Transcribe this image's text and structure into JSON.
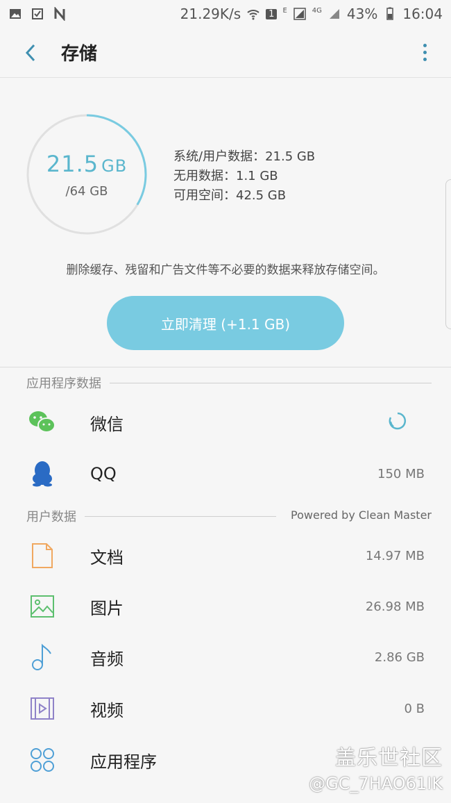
{
  "status_bar": {
    "speed": "21.29K/s",
    "sim_badge": "1",
    "net_e": "E",
    "net_4g": "4G",
    "battery": "43%",
    "time": "16:04"
  },
  "header": {
    "title": "存储"
  },
  "storage": {
    "used_value": "21.5",
    "used_unit": "GB",
    "total": "/64 GB",
    "used_fraction": 0.336,
    "stats": {
      "system_user": "系统/用户数据：21.5 GB",
      "unused": "无用数据：1.1 GB",
      "available": "可用空间：42.5 GB"
    },
    "hint": "删除缓存、残留和广告文件等不必要的数据来释放存储空间。",
    "clean_button": "立即清理 (+1.1 GB)"
  },
  "app_section": {
    "title": "应用程序数据",
    "items": [
      {
        "label": "微信",
        "icon": "wechat-icon",
        "size": ""
      },
      {
        "label": "QQ",
        "icon": "qq-icon",
        "size": "150 MB"
      }
    ]
  },
  "user_section": {
    "title": "用户数据",
    "powered_by": "Powered by Clean Master",
    "items": [
      {
        "label": "文档",
        "icon": "document-icon",
        "size": "14.97 MB"
      },
      {
        "label": "图片",
        "icon": "image-icon",
        "size": "26.98 MB"
      },
      {
        "label": "音频",
        "icon": "music-icon",
        "size": "2.86 GB"
      },
      {
        "label": "视频",
        "icon": "video-icon",
        "size": "0 B"
      },
      {
        "label": "应用程序",
        "icon": "apps-icon",
        "size": ""
      }
    ]
  },
  "watermark": {
    "line1": "盖乐世社区",
    "line2": "@GC_7HAO61IK"
  },
  "colors": {
    "accent": "#5ab6cd",
    "button": "#79cbe1",
    "background": "#f6f6f6"
  }
}
